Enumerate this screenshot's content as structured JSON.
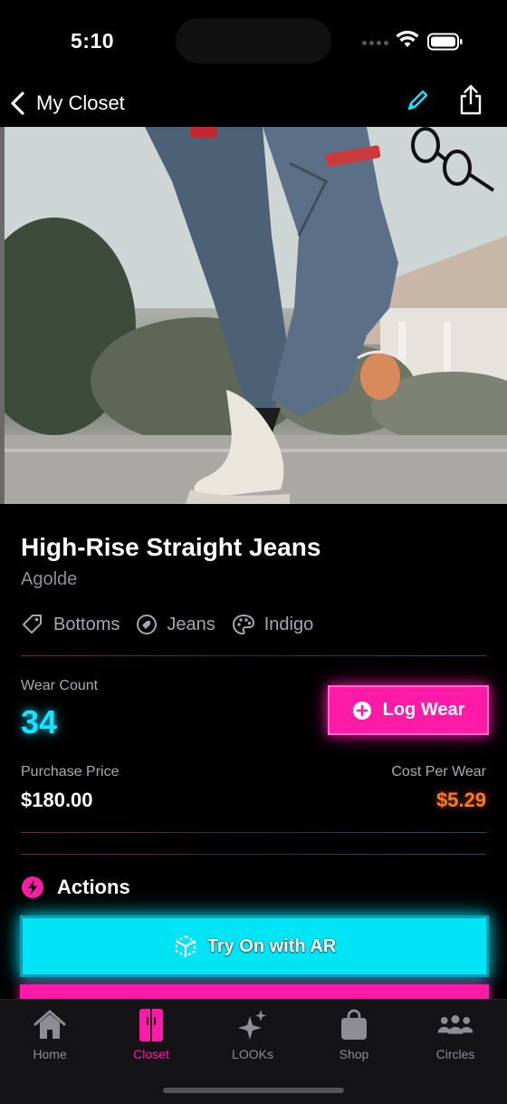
{
  "status_bar": {
    "time": "5:10"
  },
  "nav": {
    "back_label": "My Closet",
    "edit_icon": "pencil-icon",
    "share_icon": "share-icon"
  },
  "item": {
    "title": "High-Rise Straight Jeans",
    "brand": "Agolde",
    "tags": [
      {
        "icon": "tag-icon",
        "label": "Bottoms"
      },
      {
        "icon": "badge-tag-icon",
        "label": "Jeans"
      },
      {
        "icon": "palette-icon",
        "label": "Indigo"
      }
    ]
  },
  "stats": {
    "wear_count_label": "Wear Count",
    "wear_count": "34",
    "log_wear_label": "Log Wear",
    "purchase_price_label": "Purchase Price",
    "purchase_price": "$180.00",
    "cost_per_wear_label": "Cost Per Wear",
    "cost_per_wear": "$5.29"
  },
  "actions": {
    "title": "Actions",
    "try_on_label": "Try On with AR"
  },
  "tabs": [
    {
      "label": "Home",
      "icon": "house-icon",
      "active": false
    },
    {
      "label": "Closet",
      "icon": "closet-icon",
      "active": true
    },
    {
      "label": "LOOKs",
      "icon": "sparkles-icon",
      "active": false
    },
    {
      "label": "Shop",
      "icon": "shopping-bag-icon",
      "active": false
    },
    {
      "label": "Circles",
      "icon": "people-icon",
      "active": false
    }
  ],
  "colors": {
    "accent_pink": "#ff1aa8",
    "accent_cyan": "#00e4f5",
    "cost_orange": "#ff7a1a",
    "background": "#000000"
  }
}
